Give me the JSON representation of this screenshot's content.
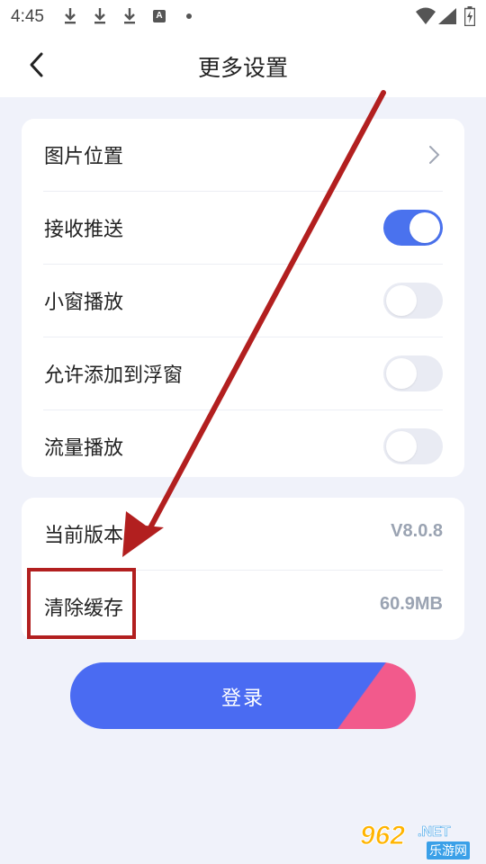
{
  "status_bar": {
    "time": "4:45",
    "app_icon_letter": "A"
  },
  "header": {
    "title": "更多设置"
  },
  "settings": {
    "image_position": {
      "label": "图片位置"
    },
    "receive_push": {
      "label": "接收推送",
      "enabled": true
    },
    "mini_window": {
      "label": "小窗播放",
      "enabled": false
    },
    "allow_float": {
      "label": "允许添加到浮窗",
      "enabled": false
    },
    "data_play": {
      "label": "流量播放",
      "enabled": false
    }
  },
  "info": {
    "version": {
      "label": "当前版本",
      "value": "V8.0.8"
    },
    "cache": {
      "label": "清除缓存",
      "value": "60.9MB"
    }
  },
  "login_button": {
    "label": "登录"
  },
  "watermark": {
    "number": "962",
    "suffix": ".NET",
    "site": "乐游网"
  },
  "colors": {
    "accent": "#4a72ee",
    "button_blue": "#4a6bf2",
    "button_pink": "#f25a8c",
    "annotation_red": "#b21f1f",
    "background": "#f0f2fa"
  }
}
